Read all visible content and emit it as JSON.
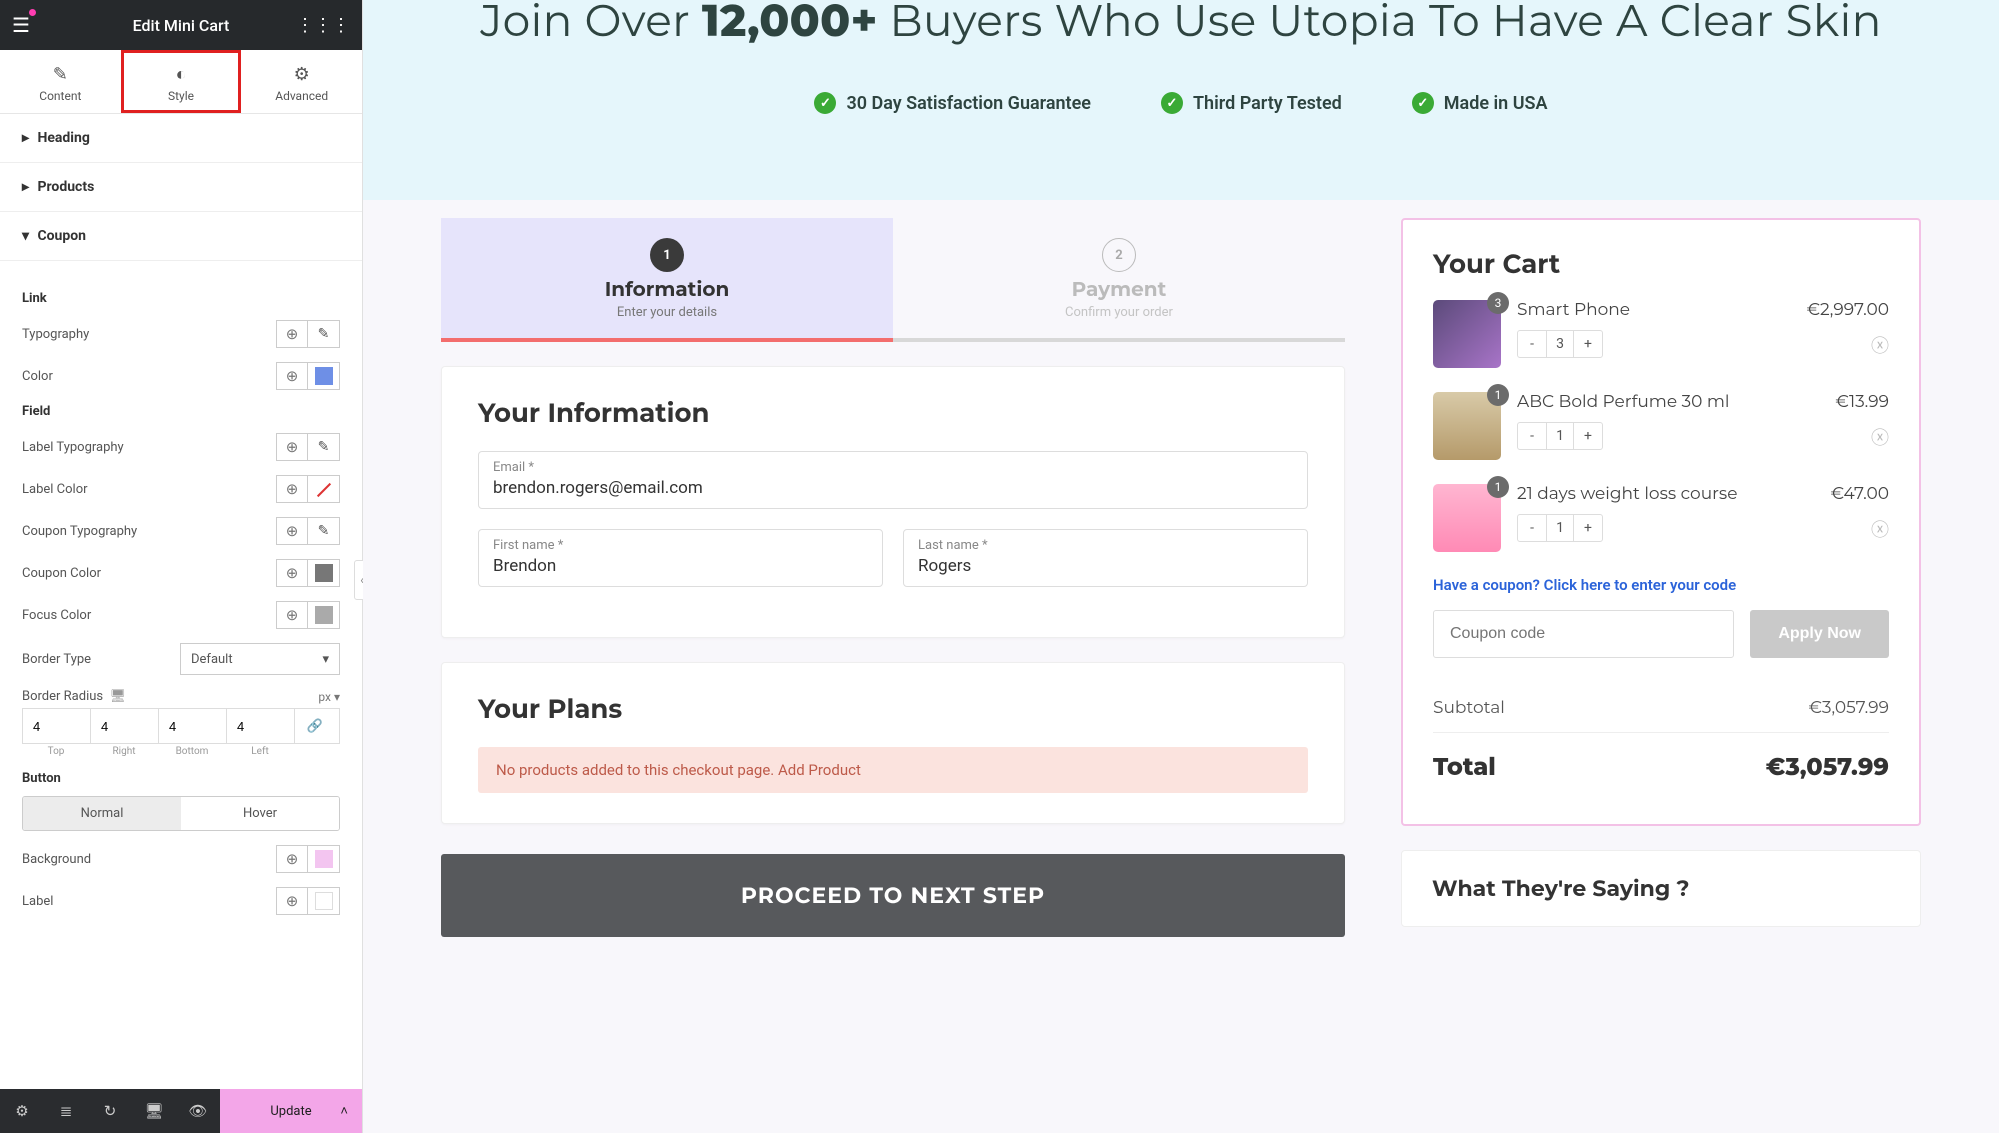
{
  "sidebar": {
    "title": "Edit Mini Cart",
    "tabs": {
      "content": "Content",
      "style": "Style",
      "advanced": "Advanced"
    },
    "accordions": {
      "heading": "Heading",
      "products": "Products",
      "coupon": "Coupon"
    },
    "link_section": "Link",
    "typography_label": "Typography",
    "color_label": "Color",
    "field_section": "Field",
    "label_typo": "Label Typography",
    "label_color": "Label Color",
    "coupon_typo": "Coupon Typography",
    "coupon_color": "Coupon Color",
    "focus_color": "Focus Color",
    "border_type_label": "Border Type",
    "border_type_value": "Default",
    "border_radius_label": "Border Radius",
    "border_radius_unit": "px",
    "radius": {
      "top": "4",
      "right": "4",
      "bottom": "4",
      "left": "4"
    },
    "radius_labels": {
      "top": "Top",
      "right": "Right",
      "bottom": "Bottom",
      "left": "Left"
    },
    "button_section": "Button",
    "btn_states": {
      "normal": "Normal",
      "hover": "Hover"
    },
    "background_label": "Background",
    "label_label": "Label",
    "update": "Update"
  },
  "hero": {
    "pre": "Join Over ",
    "count": "12,000+",
    "post": " Buyers Who Use Utopia To Have A Clear Skin",
    "trust": [
      "30 Day Satisfaction Guarantee",
      "Third Party Tested",
      "Made in USA"
    ]
  },
  "steps": {
    "s1": {
      "num": "1",
      "title": "Information",
      "sub": "Enter your details"
    },
    "s2": {
      "num": "2",
      "title": "Payment",
      "sub": "Confirm your order"
    }
  },
  "info": {
    "title": "Your Information",
    "email_label": "Email *",
    "email": "brendon.rogers@email.com",
    "first_label": "First name *",
    "first": "Brendon",
    "last_label": "Last name *",
    "last": "Rogers"
  },
  "plans": {
    "title": "Your Plans",
    "alert_text": "No products added to this checkout page. ",
    "alert_link": "Add Product"
  },
  "proceed": "PROCEED TO NEXT STEP",
  "cart": {
    "title": "Your Cart",
    "items": [
      {
        "name": "Smart Phone",
        "price": "€2,997.00",
        "qty": "3",
        "badge": "3"
      },
      {
        "name": "ABC Bold Perfume 30 ml",
        "price": "€13.99",
        "qty": "1",
        "badge": "1"
      },
      {
        "name": "21 days weight loss course",
        "price": "€47.00",
        "qty": "1",
        "badge": "1"
      }
    ],
    "coupon_link": "Have a coupon? Click here to enter your code",
    "coupon_placeholder": "Coupon code",
    "apply": "Apply Now",
    "subtotal_label": "Subtotal",
    "subtotal": "€3,057.99",
    "total_label": "Total",
    "total": "€3,057.99"
  },
  "testimonials_title": "What They're Saying ?"
}
